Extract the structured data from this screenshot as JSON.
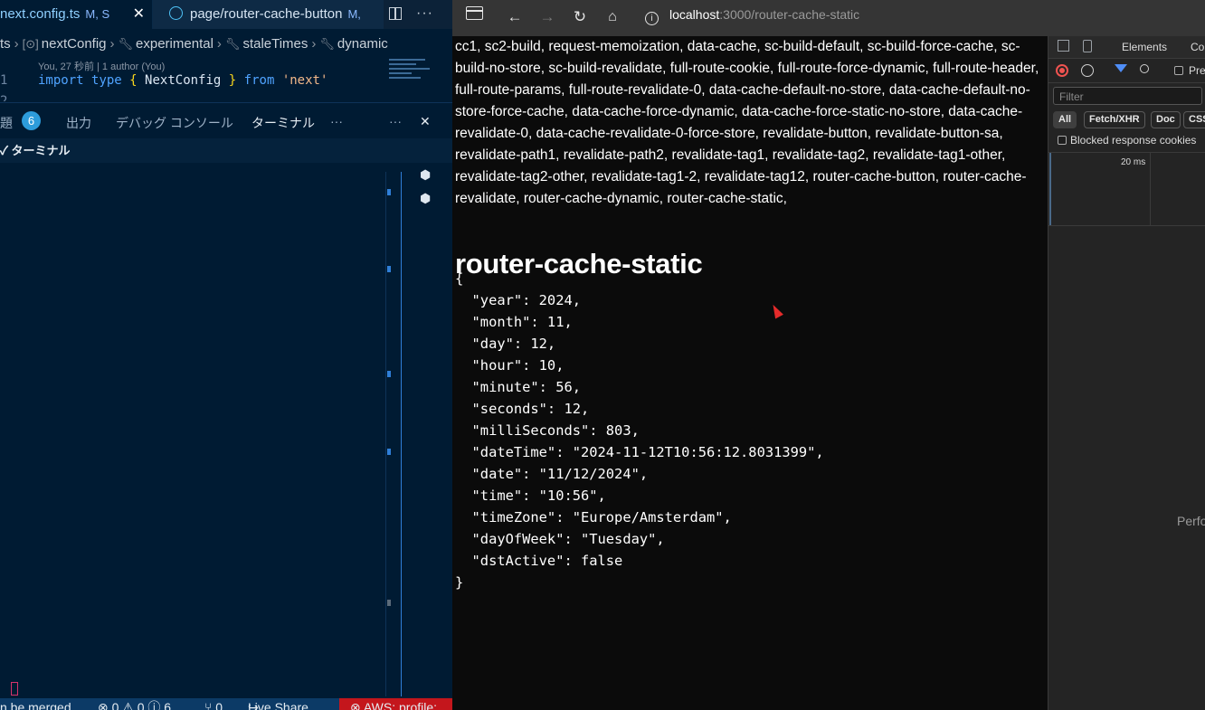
{
  "vscode": {
    "tabs": [
      {
        "label": "next.config.ts",
        "modified": "M, S",
        "close": "✕"
      },
      {
        "label": "page/router-cache-button",
        "modified": "M,"
      }
    ],
    "breadcrumb": {
      "root": "ts",
      "items": [
        "nextConfig",
        "experimental",
        "staleTimes",
        "dynamic"
      ]
    },
    "blame": "You, 27 秒前 | 1 author (You)",
    "line_numbers": [
      "1",
      "2"
    ],
    "code": {
      "kw1": "import",
      "kw2": "type",
      "open": "{",
      "name": "NextConfig",
      "close": "}",
      "kw3": "from",
      "module": "'next'"
    },
    "panel_tabs": {
      "problems": "題",
      "problems_count": "6",
      "output": "出力",
      "debug": "デバッグ コンソール",
      "terminal": "ターミナル",
      "more": "···"
    },
    "terminal_header": "ターミナル",
    "status": {
      "merge": "n be merged",
      "problems": "⊗ 0 ⚠ 0 ⓘ 6",
      "ports": "⑂ 0",
      "live_share": "Live Share",
      "aws": "⊗ AWS: profile:"
    }
  },
  "browser": {
    "url_host": "localhost",
    "url_path": ":3000/router-cache-static"
  },
  "page": {
    "route_list": "cc1, sc2-build, request-memoization, data-cache, sc-build-default, sc-build-force-cache, sc-build-no-store, sc-build-revalidate, full-route-cookie, full-route-force-dynamic, full-route-header, full-route-params, full-route-revalidate-0, data-cache-default-no-store, data-cache-default-no-store-force-cache, data-cache-force-dynamic, data-cache-force-static-no-store, data-cache-revalidate-0, data-cache-revalidate-0-force-store, revalidate-button, revalidate-button-sa, revalidate-path1, revalidate-path2, revalidate-tag1, revalidate-tag2, revalidate-tag1-other, revalidate-tag2-other, revalidate-tag1-2, revalidate-tag12, router-cache-button, router-cache-revalidate, router-cache-dynamic, router-cache-static,",
    "title": "router-cache-static",
    "json_text": "{\n  \"year\": 2024,\n  \"month\": 11,\n  \"day\": 12,\n  \"hour\": 10,\n  \"minute\": 56,\n  \"seconds\": 12,\n  \"milliSeconds\": 803,\n  \"dateTime\": \"2024-11-12T10:56:12.8031399\",\n  \"date\": \"11/12/2024\",\n  \"time\": \"10:56\",\n  \"timeZone\": \"Europe/Amsterdam\",\n  \"dayOfWeek\": \"Tuesday\",\n  \"dstActive\": false\n}"
  },
  "devtools": {
    "tabs": [
      "Elements",
      "Co"
    ],
    "preserve_label": "Pre",
    "filter_placeholder": "Filter",
    "type_filters": [
      "All",
      "Fetch/XHR",
      "Doc",
      "CSS"
    ],
    "blocked_cookies": "Blocked response cookies",
    "timeline_label": "20 ms",
    "perf_label": "Perfo"
  }
}
